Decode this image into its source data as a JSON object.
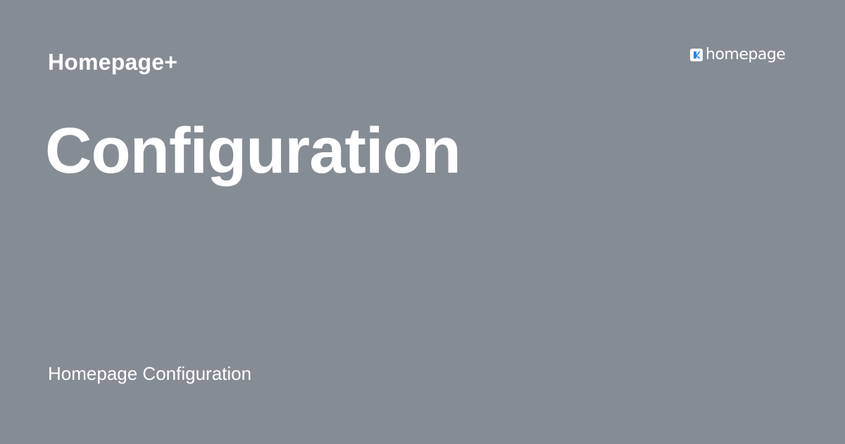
{
  "header": {
    "site_name": "Homepage+",
    "logo": {
      "icon": "homepage-logo-icon",
      "text": "homepage",
      "accent": "#1e88e5"
    }
  },
  "main": {
    "title": "Configuration"
  },
  "footer": {
    "caption": "Homepage Configuration"
  },
  "colors": {
    "background": "#868c93",
    "text": "#ffffff"
  }
}
